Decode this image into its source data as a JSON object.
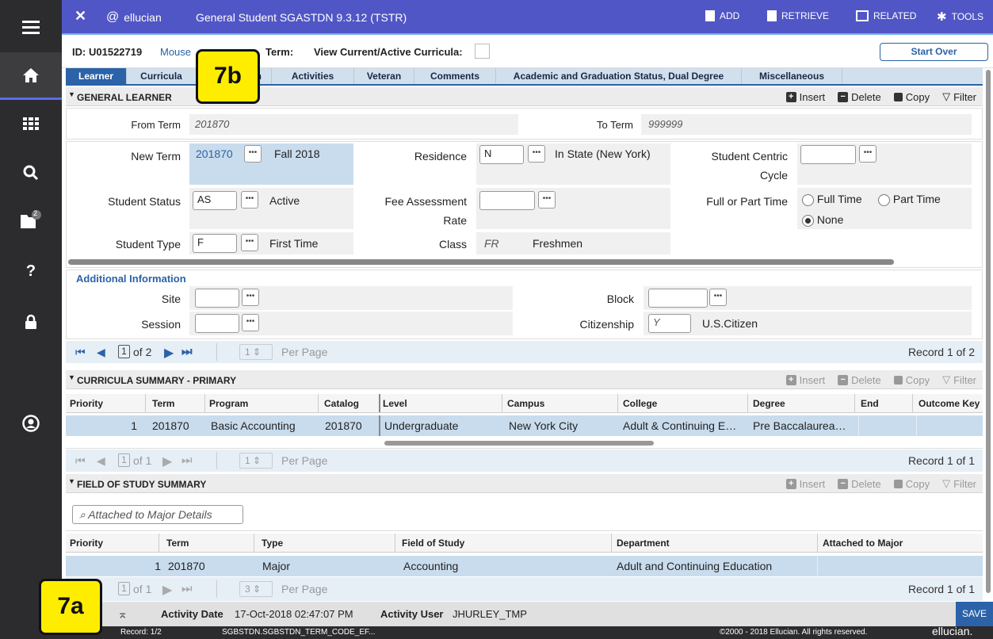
{
  "header": {
    "brand": "ellucian",
    "page_title": "General Student SGASTDN 9.3.12 (TSTR)",
    "buttons": {
      "add": "ADD",
      "retrieve": "RETRIEVE",
      "related": "RELATED",
      "tools": "TOOLS"
    }
  },
  "sidebar": {
    "notification_count": "2"
  },
  "keyblock": {
    "id_label": "ID:",
    "id_value": "U01522719",
    "name": "Mouse",
    "term_label": "Term:",
    "view_label": "View Current/Active Curricula:",
    "start_over": "Start Over"
  },
  "tabs": [
    "Learner",
    "Curricula",
    "",
    "Activities",
    "Veteran",
    "Comments",
    "Academic and Graduation Status, Dual Degree",
    "Miscellaneous"
  ],
  "tab_fragment": "h",
  "general_learner": {
    "title": "GENERAL LEARNER",
    "actions": {
      "insert": "Insert",
      "delete": "Delete",
      "copy": "Copy",
      "filter": "Filter"
    },
    "from_term_label": "From Term",
    "from_term": "201870",
    "to_term_label": "To Term",
    "to_term": "999999",
    "new_term_label": "New Term",
    "new_term": "201870",
    "new_term_desc": "Fall 2018",
    "residence_label": "Residence",
    "residence": "N",
    "residence_desc": "In State (New York)",
    "student_centric_label_1": "Student Centric",
    "student_centric_label_2": "Cycle",
    "student_status_label": "Student Status",
    "student_status": "AS",
    "student_status_desc": "Active",
    "fee_label_1": "Fee Assessment",
    "fee_label_2": "Rate",
    "full_part_label": "Full or Part Time",
    "full_time": "Full Time",
    "part_time": "Part Time",
    "none": "None",
    "student_type_label": "Student Type",
    "student_type": "F",
    "student_type_desc": "First Time",
    "class_label": "Class",
    "class_code": "FR",
    "class_desc": "Freshmen",
    "additional_info": "Additional Information",
    "site_label": "Site",
    "block_label": "Block",
    "session_label": "Session",
    "citizenship_label": "Citizenship",
    "citizenship": "Y",
    "citizenship_desc": "U.S.Citizen",
    "pager": {
      "page": "1",
      "of": "of 2",
      "per_page_value": "1",
      "per_page": "Per Page",
      "record": "Record 1 of 2"
    }
  },
  "curricula_summary": {
    "title": "CURRICULA SUMMARY - PRIMARY",
    "columns": [
      "Priority",
      "Term",
      "Program",
      "Catalog",
      "Level",
      "Campus",
      "College",
      "Degree",
      "End",
      "Outcome Key"
    ],
    "row": [
      "1",
      "201870",
      "Basic Accounting",
      "201870",
      "Undergraduate",
      "New York City",
      "Adult & Continuing E…",
      "Pre Baccalaurea…",
      "",
      ""
    ],
    "pager": {
      "page": "1",
      "of": "of 1",
      "per_page_value": "1",
      "per_page": "Per Page",
      "record": "Record 1 of 1"
    }
  },
  "field_of_study": {
    "title": "FIELD OF STUDY SUMMARY",
    "search_placeholder": "Attached to Major Details",
    "columns": [
      "Priority",
      "Term",
      "Type",
      "Field of Study",
      "Department",
      "Attached to Major"
    ],
    "row": [
      "1",
      "201870",
      "Major",
      "Accounting",
      "Adult and Continuing Education",
      ""
    ],
    "pager": {
      "page": "1",
      "of": "of 1",
      "per_page_value": "3",
      "per_page": "Per Page",
      "record": "Record 1 of 1"
    }
  },
  "footer": {
    "activity_date_label": "Activity Date",
    "activity_date": "17-Oct-2018 02:47:07 PM",
    "activity_user_label": "Activity User",
    "activity_user": "JHURLEY_TMP",
    "save": "SAVE"
  },
  "status_bar": {
    "record": "Record: 1/2",
    "field": "SGBSTDN.SGBSTDN_TERM_CODE_EF...",
    "copyright": "©2000 - 2018 Ellucian. All rights reserved.",
    "logo": "ellucian."
  },
  "callouts": {
    "a": "7a",
    "b": "7b"
  },
  "colors": {
    "header": "#5156c6",
    "tab_active": "#2b62a8",
    "selected_row": "#c9dced",
    "callout": "#ffed00"
  }
}
